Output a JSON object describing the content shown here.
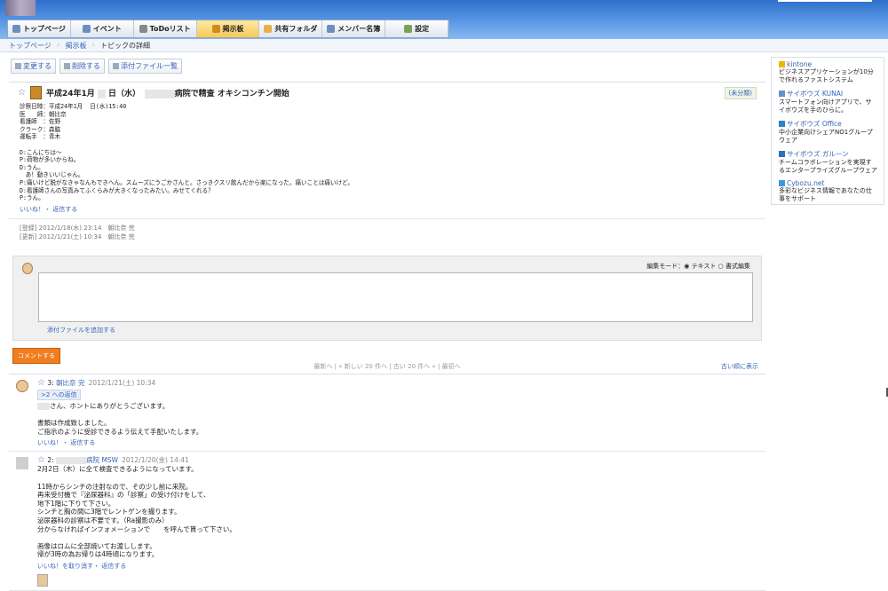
{
  "nav": {
    "tabs": [
      {
        "label": "トップページ",
        "icon": "home-icon"
      },
      {
        "label": "イベント",
        "icon": "calendar-icon"
      },
      {
        "label": "ToDoリスト",
        "icon": "todo-icon"
      },
      {
        "label": "掲示板",
        "icon": "bulletin-icon",
        "active": true
      },
      {
        "label": "共有フォルダ",
        "icon": "folder-icon"
      },
      {
        "label": "メンバー名簿",
        "icon": "members-icon"
      },
      {
        "label": "設定",
        "icon": "settings-icon"
      }
    ]
  },
  "breadcrumb": [
    "トップページ",
    "掲示板",
    "トピックの詳細"
  ],
  "toolbar": {
    "edit": "変更する",
    "delete": "削除する",
    "attachments": "添付ファイル一覧"
  },
  "topic": {
    "title_prefix": "平成24年1月",
    "title_day": "日（水）",
    "title_suffix": "病院で精査 オキシコンチン開始",
    "category": "(未分類)",
    "body": "診察日時：平成24年1月  日(水)15:40\n医　　師：朝比奈\n看護師　：佐野\nクラーク：森脇\n運転手　：青木\n\nD:こんにちは～\nP:荷物が多いからね。\nD:うん。\n　あ！動きいいじゃん。\nP:痛いけど脱がなきゃなんもできへん。スムーズにうごかさんと。さっきクスリ飲んだから楽になった。痛いことは痛いけど。\nD:看護師さんの写真みてふくらみが大きくなったみたい。みせてくれる？\nP:うん。",
    "like_reply": "いいね！・ 返信する",
    "registered": "[登録] 2012/1/18(水) 23:14　朝比奈 完",
    "updated": "[更新] 2012/1/21(土) 10:34　朝比奈 完"
  },
  "comment_form": {
    "mode_label": "編集モード：◉ テキスト ○ 書式編集",
    "attach_label": "添付ファイルを追加する",
    "submit_label": "コメントする"
  },
  "pager": {
    "text": "最新へ | « 新しい 20 件へ | 古い 20 件へ » | 最初へ",
    "sort": "古い順に表示"
  },
  "comments": [
    {
      "num": "3:",
      "author": "朝比奈 完",
      "date": "2012/1/21(土) 10:34",
      "reply_to": ">2 への返信",
      "text": "さん、ホントにありがとうございます。\n\n書類は作成致しました。\nご指示のように受診できるよう伝えて手配いたします。",
      "actions": "いいね！・ 返信する"
    },
    {
      "num": "2:",
      "author": "病院 MSW",
      "date": "2012/1/20(金) 14:41",
      "text": "2月2日（木）に全て検査できるようになっています。\n\n11時からシンチの注射なので、その少し前に来院。\n再来受付機で『泌尿器科』の「診察」の受け付けをして、\n地下1階に下りて下さい。\nシンチと胸の間に3階でレントゲンを撮ります。\n泌尿器科の診察は不要です。（Ra撮影のみ）\n分からなければインフォメーションで　　を呼んで貰って下さい。\n\n画像はロムに全部焼いてお渡しします。\n帰が3時の為お帰りは4時頃になります。",
      "actions": "いいね！を取り消す・ 返信する"
    }
  ],
  "sidebar": [
    {
      "name": "kintone",
      "desc": "ビジネスアプリケーションが10分で作れるファストシステム"
    },
    {
      "name": "サイボウズ KUNAI",
      "desc": "スマートフォン向けアプリで、サイボウズを手のひらに。"
    },
    {
      "name": "サイボウズ Office",
      "desc": "中小企業向けシェアNO1グループウェア"
    },
    {
      "name": "サイボウズ ガルーン",
      "desc": "チームコラボレーションを実現するエンタープライズグループウェア"
    },
    {
      "name": "Cybozu.net",
      "desc": "多彩なビジネス情報であなたの仕事をサポート"
    }
  ]
}
